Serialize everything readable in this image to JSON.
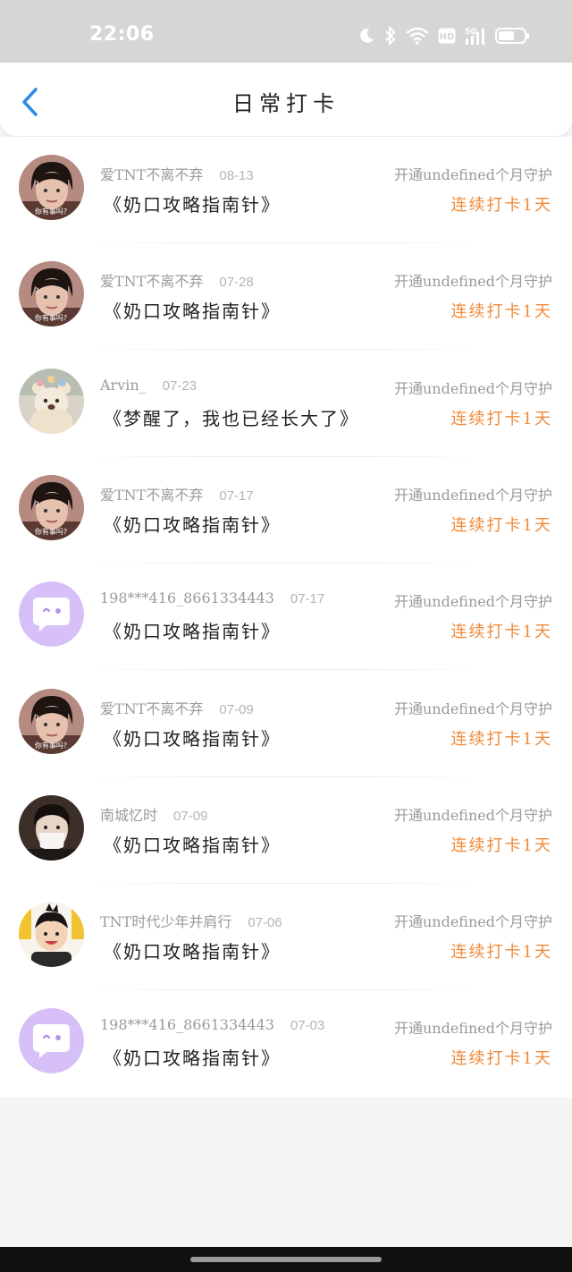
{
  "status_bar": {
    "time": "22:06",
    "icons": [
      "moon-icon",
      "bluetooth-icon",
      "wifi-icon",
      "hd-icon",
      "signal-5g-icon",
      "battery-icon"
    ]
  },
  "header": {
    "title": "日常打卡",
    "back_icon": "back-arrow-icon"
  },
  "colors": {
    "accent_blue": "#2b8ce6",
    "streak_orange": "#f08a3a"
  },
  "items": [
    {
      "avatar": "girl-photo",
      "name": "爱TNT不离不弃",
      "date": "08-13",
      "topic": "《奶口攻略指南针》",
      "guard": "开通undefined个月守护",
      "streak": "连续打卡1天"
    },
    {
      "avatar": "girl-photo",
      "name": "爱TNT不离不弃",
      "date": "07-28",
      "topic": "《奶口攻略指南针》",
      "guard": "开通undefined个月守护",
      "streak": "连续打卡1天"
    },
    {
      "avatar": "bear-photo",
      "name": "Arvin_",
      "date": "07-23",
      "topic": "《梦醒了，我也已经长大了》",
      "guard": "开通undefined个月守护",
      "streak": "连续打卡1天"
    },
    {
      "avatar": "girl-photo",
      "name": "爱TNT不离不弃",
      "date": "07-17",
      "topic": "《奶口攻略指南针》",
      "guard": "开通undefined个月守护",
      "streak": "连续打卡1天"
    },
    {
      "avatar": "default-chat",
      "name": "198***416_8661334443",
      "date": "07-17",
      "topic": "《奶口攻略指南针》",
      "guard": "开通undefined个月守护",
      "streak": "连续打卡1天"
    },
    {
      "avatar": "girl-photo",
      "name": "爱TNT不离不弃",
      "date": "07-09",
      "topic": "《奶口攻略指南针》",
      "guard": "开通undefined个月守护",
      "streak": "连续打卡1天"
    },
    {
      "avatar": "mask-photo",
      "name": "南城忆时",
      "date": "07-09",
      "topic": "《奶口攻略指南针》",
      "guard": "开通undefined个月守护",
      "streak": "连续打卡1天"
    },
    {
      "avatar": "kid-photo",
      "name": "TNT时代少年并肩行",
      "date": "07-06",
      "topic": "《奶口攻略指南针》",
      "guard": "开通undefined个月守护",
      "streak": "连续打卡1天"
    },
    {
      "avatar": "default-chat",
      "name": "198***416_8661334443",
      "date": "07-03",
      "topic": "《奶口攻略指南针》",
      "guard": "开通undefined个月守护",
      "streak": "连续打卡1天"
    }
  ]
}
